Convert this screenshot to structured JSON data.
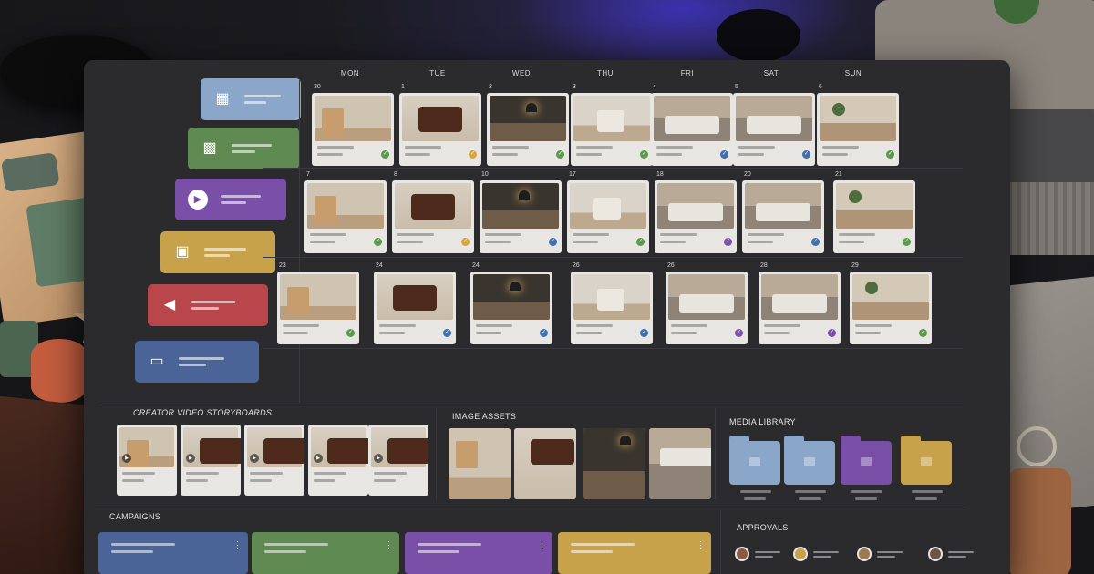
{
  "days": [
    "MON",
    "TUE",
    "WED",
    "THU",
    "FRI",
    "SAT",
    "SUN"
  ],
  "weeks": [
    [
      "30",
      "1",
      "2",
      "3",
      "4",
      "5",
      "6"
    ],
    [
      "7",
      "8",
      "10",
      "17",
      "18",
      "20",
      "21"
    ],
    [
      "23",
      "24",
      "24",
      "26",
      "26",
      "28",
      "29"
    ]
  ],
  "panels": {
    "storyboards_title": "CREATOR VIDEO STORYBOARDS",
    "image_assets_title": "IMAGE ASSETS",
    "media_library_title": "MEDIA LIBRARY",
    "campaigns_title": "CAMPAIGNS",
    "approvals_title": "APPROVALS"
  },
  "sidebar_icons": [
    "calendar-icon",
    "grid-icon",
    "play-icon",
    "image-icon",
    "megaphone-icon",
    "folder-icon"
  ],
  "colors": {
    "blue": "#4a6497",
    "green": "#5f8a52",
    "purple": "#7a4fa7",
    "gold": "#c7a24a",
    "red": "#b8464a",
    "light_blue": "#8aa6c9",
    "check_green": "#5a9a4a",
    "check_gold": "#d7a63a",
    "check_blue": "#3f6fae",
    "check_purple": "#7a4fa7"
  }
}
